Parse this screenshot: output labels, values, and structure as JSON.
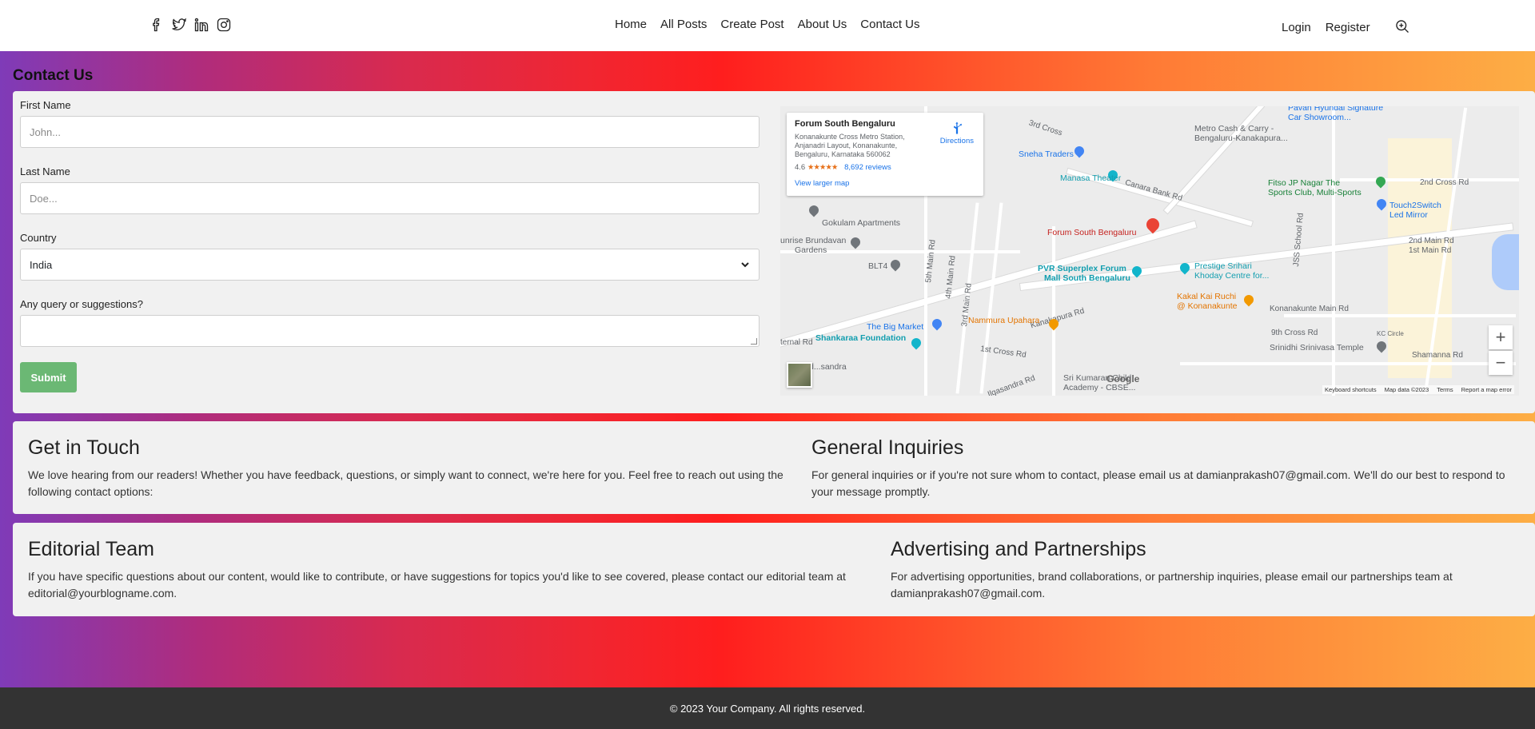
{
  "header": {
    "social": [
      "facebook-icon",
      "twitter-icon",
      "linkedin-icon",
      "instagram-icon"
    ],
    "nav": [
      "Home",
      "All Posts",
      "Create Post",
      "About Us",
      "Contact Us"
    ],
    "auth": {
      "login": "Login",
      "register": "Register"
    }
  },
  "page": {
    "title": "Contact Us"
  },
  "form": {
    "first_name_label": "First Name",
    "first_name_placeholder": "John...",
    "last_name_label": "Last Name",
    "last_name_placeholder": "Doe...",
    "country_label": "Country",
    "country_value": "India",
    "query_label": "Any query or suggestions?",
    "submit": "Submit"
  },
  "map": {
    "place_name": "Forum South Bengaluru",
    "address": "Konanakunte Cross Metro Station, Anjanadri Layout, Konanakunte, Bengaluru, Karnataka 560062",
    "rating": "4.6",
    "stars": "★★★★★",
    "reviews": "8,692 reviews",
    "directions": "Directions",
    "larger_map": "View larger map",
    "footer": {
      "shortcuts": "Keyboard shortcuts",
      "mapdata": "Map data ©2023",
      "terms": "Terms",
      "report": "Report a map error"
    },
    "logo": "Google",
    "labels": {
      "sneha": "Sneha Traders",
      "manasa": "Manasa Theater",
      "metro": "Metro Cash & Carry -",
      "metro2": "Bengaluru-Kanakapura...",
      "pavan": "Pavan Hyundai Signature",
      "pavan2": "Car Showroom...",
      "fitso": "Fitso JP Nagar The",
      "fitso2": "Sports Club, Multi-Sports",
      "touch": "Touch2Switch",
      "touch2": "Led Mirror",
      "gokulam": "Gokulam Apartments",
      "sunrise": "unrise Brundavan",
      "sunrise2": "Gardens",
      "blt4": "BLT4",
      "forum": "Forum South Bengaluru",
      "pvr": "PVR Superplex Forum",
      "pvr2": "Mall South Bengaluru",
      "prestige": "Prestige Srihari",
      "prestige2": "Khoday Centre for...",
      "kakal": "Kakal Kai Ruchi",
      "kakal2": "@ Konanakunte",
      "bigmarket": "The Big Market",
      "nammura": "Nammura Upahara",
      "shankaraa": "Shankaraa Foundation",
      "srinidhi": "Srinidhi Srinivasa Temple",
      "kumaran": "Sri Kumaran Child",
      "kumaran2": "Academy - CBSE...",
      "canara": "Canara Bank Rd",
      "kanakapura": "Kanakapura Rd",
      "crossmain": "2nd Cross Rd",
      "main1": "1st Main Rd",
      "main2": "2nd Main Rd",
      "jss": "JSS School Rd",
      "konanakunte": "Konanakunte Main Rd",
      "ninth": "9th Cross Rd",
      "shamanna": "Shamanna Rd",
      "kc": "KC Circle",
      "fifth": "5th Main Rd",
      "fourth": "4th Main Rd",
      "third": "3rd Main Rd",
      "first_cross": "1st Cross Rd",
      "thirdcross": "3rd Cross",
      "sandra": "Ilgasandra Rd",
      "nternal": "ternal Rd",
      "dsandra": "d...sandra"
    }
  },
  "sections": [
    {
      "title": "Get in Touch",
      "text": "We love hearing from our readers! Whether you have feedback, questions, or simply want to connect, we're here for you. Feel free to reach out using the following contact options:"
    },
    {
      "title": "General Inquiries",
      "text": "For general inquiries or if you're not sure whom to contact, please email us at damianprakash07@gmail.com. We'll do our best to respond to your message promptly."
    },
    {
      "title": "Editorial Team",
      "text": "If you have specific questions about our content, would like to contribute, or have suggestions for topics you'd like to see covered, please contact our editorial team at editorial@yourblogname.com."
    },
    {
      "title": "Advertising and Partnerships",
      "text": "For advertising opportunities, brand collaborations, or partnership inquiries, please email our partnerships team at damianprakash07@gmail.com."
    }
  ],
  "footer": {
    "text": "© 2023 Your Company. All rights reserved."
  }
}
